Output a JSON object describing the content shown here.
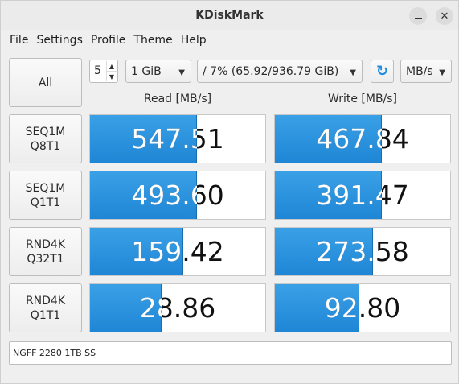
{
  "window": {
    "title": "KDiskMark"
  },
  "menu": [
    "File",
    "Settings",
    "Profile",
    "Theme",
    "Help"
  ],
  "controls": {
    "all_label": "All",
    "runs": "5",
    "size": "1 GiB",
    "drive": "/ 7% (65.92/936.79 GiB)",
    "unit": "MB/s",
    "refresh_icon": "refresh-icon"
  },
  "headers": {
    "read": "Read [MB/s]",
    "write": "Write [MB/s]"
  },
  "tests": [
    {
      "line1": "SEQ1M",
      "line2": "Q8T1",
      "read": "547.51",
      "read_fill": 0.61,
      "write": "467.84",
      "write_fill": 0.61
    },
    {
      "line1": "SEQ1M",
      "line2": "Q1T1",
      "read": "493.60",
      "read_fill": 0.61,
      "write": "391.47",
      "write_fill": 0.61
    },
    {
      "line1": "RND4K",
      "line2": "Q32T1",
      "read": "159.42",
      "read_fill": 0.53,
      "write": "273.58",
      "write_fill": 0.56
    },
    {
      "line1": "RND4K",
      "line2": "Q1T1",
      "read": "28.86",
      "read_fill": 0.41,
      "write": "92.80",
      "write_fill": 0.48
    }
  ],
  "footer": {
    "device": "NGFF 2280 1TB SS"
  },
  "colors": {
    "bar": "#2a90dc",
    "accent": "#1c8ce0"
  }
}
